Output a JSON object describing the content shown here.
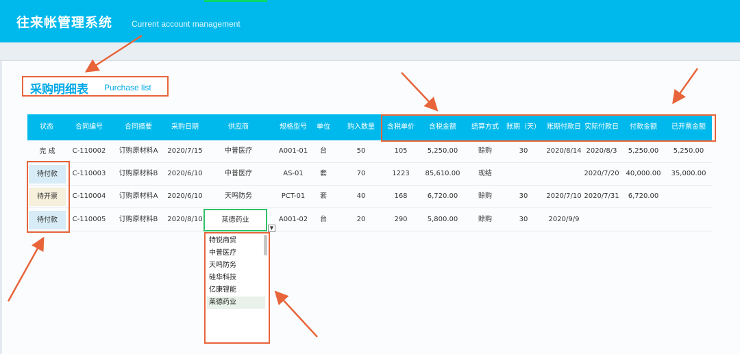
{
  "app": {
    "title": "往来帐管理系统",
    "subtitle": "Current account management"
  },
  "page": {
    "title": "采购明细表",
    "title_en": "Purchase list"
  },
  "table": {
    "headers": [
      "状态",
      "合同编号",
      "合同摘要",
      "采购日期",
      "供应商",
      "规格型号",
      "单位",
      "购入数量",
      "含税单价",
      "含税金额",
      "结算方式",
      "账期（天）",
      "账期付款日",
      "实际付款日",
      "付款金额",
      "已开票金额"
    ],
    "rows": [
      {
        "status": "完  成",
        "status_style": "plain",
        "contract_no": "C-110002",
        "summary": "订购原材料A",
        "date": "2020/7/15",
        "supplier": "中普医疗",
        "model": "A001-01",
        "unit": "台",
        "qty": "50",
        "price": "105",
        "amount": "5,250.00",
        "settle": "赊购",
        "term": "30",
        "due": "2020/8/14",
        "paid_date": "2020/8/3",
        "paid": "5,250.00",
        "invoiced": "5,250.00"
      },
      {
        "status": "待付款",
        "status_style": "blue",
        "contract_no": "C-110003",
        "summary": "订购原材料B",
        "date": "2020/6/10",
        "supplier": "中普医疗",
        "model": "AS-01",
        "unit": "套",
        "qty": "70",
        "price": "1223",
        "amount": "85,610.00",
        "settle": "现结",
        "term": "",
        "due": "",
        "paid_date": "2020/7/20",
        "paid": "40,000.00",
        "invoiced": "35,000.00"
      },
      {
        "status": "待开票",
        "status_style": "beige",
        "contract_no": "C-110004",
        "summary": "订购原材料A",
        "date": "2020/6/10",
        "supplier": "天鸣防务",
        "model": "PCT-01",
        "unit": "套",
        "qty": "40",
        "price": "168",
        "amount": "6,720.00",
        "settle": "赊购",
        "term": "30",
        "due": "2020/7/10",
        "paid_date": "2020/7/31",
        "paid": "6,720.00",
        "invoiced": ""
      },
      {
        "status": "待付款",
        "status_style": "blue",
        "contract_no": "C-110005",
        "summary": "订购原材料B",
        "date": "2020/8/10",
        "supplier": "莱德药业",
        "model": "A001-02",
        "unit": "台",
        "qty": "20",
        "price": "290",
        "amount": "5,800.00",
        "settle": "赊购",
        "term": "30",
        "due": "2020/9/9",
        "paid_date": "",
        "paid": "",
        "invoiced": ""
      }
    ]
  },
  "supplier_dropdown": {
    "options": [
      "特锐商贸",
      "中普医疗",
      "天鸣防务",
      "硅华科技",
      "亿康锂能",
      "莱德药业"
    ],
    "selected": "莱德药业"
  },
  "colors": {
    "header": "#00b9ec",
    "annotation": "#e8643a",
    "selection": "#2fc167"
  }
}
